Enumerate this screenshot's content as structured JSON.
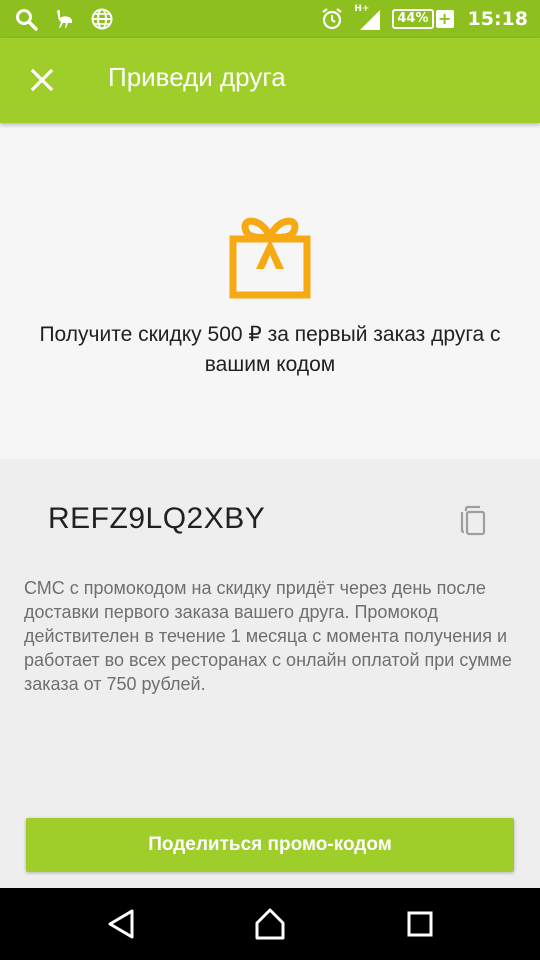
{
  "status_bar": {
    "network": "H+",
    "battery": "44%",
    "battery_plus": "+",
    "time": "15:18"
  },
  "app_bar": {
    "title": "Приведи друга",
    "close_icon": "close-icon"
  },
  "hero": {
    "icon": "gift-icon",
    "text": "Получите скидку 500 ₽ за первый заказ друга с вашим кодом"
  },
  "promo": {
    "code": "REFZ9LQ2XBY",
    "copy_icon": "copy-icon",
    "info": "СМС с промокодом на скидку придёт через день после доставки первого заказа вашего друга. Промокод действителен в течение 1 месяца с момента получения и работает во всех ресторанах с онлайн оплатой при сумме заказа от 750 рублей."
  },
  "share_button": {
    "label": "Поделиться промо-кодом"
  },
  "colors": {
    "status_bar": "#8dbf1e",
    "app_bar": "#9fcd2a",
    "accent_orange": "#f7a914",
    "button": "#9fcd2a"
  }
}
